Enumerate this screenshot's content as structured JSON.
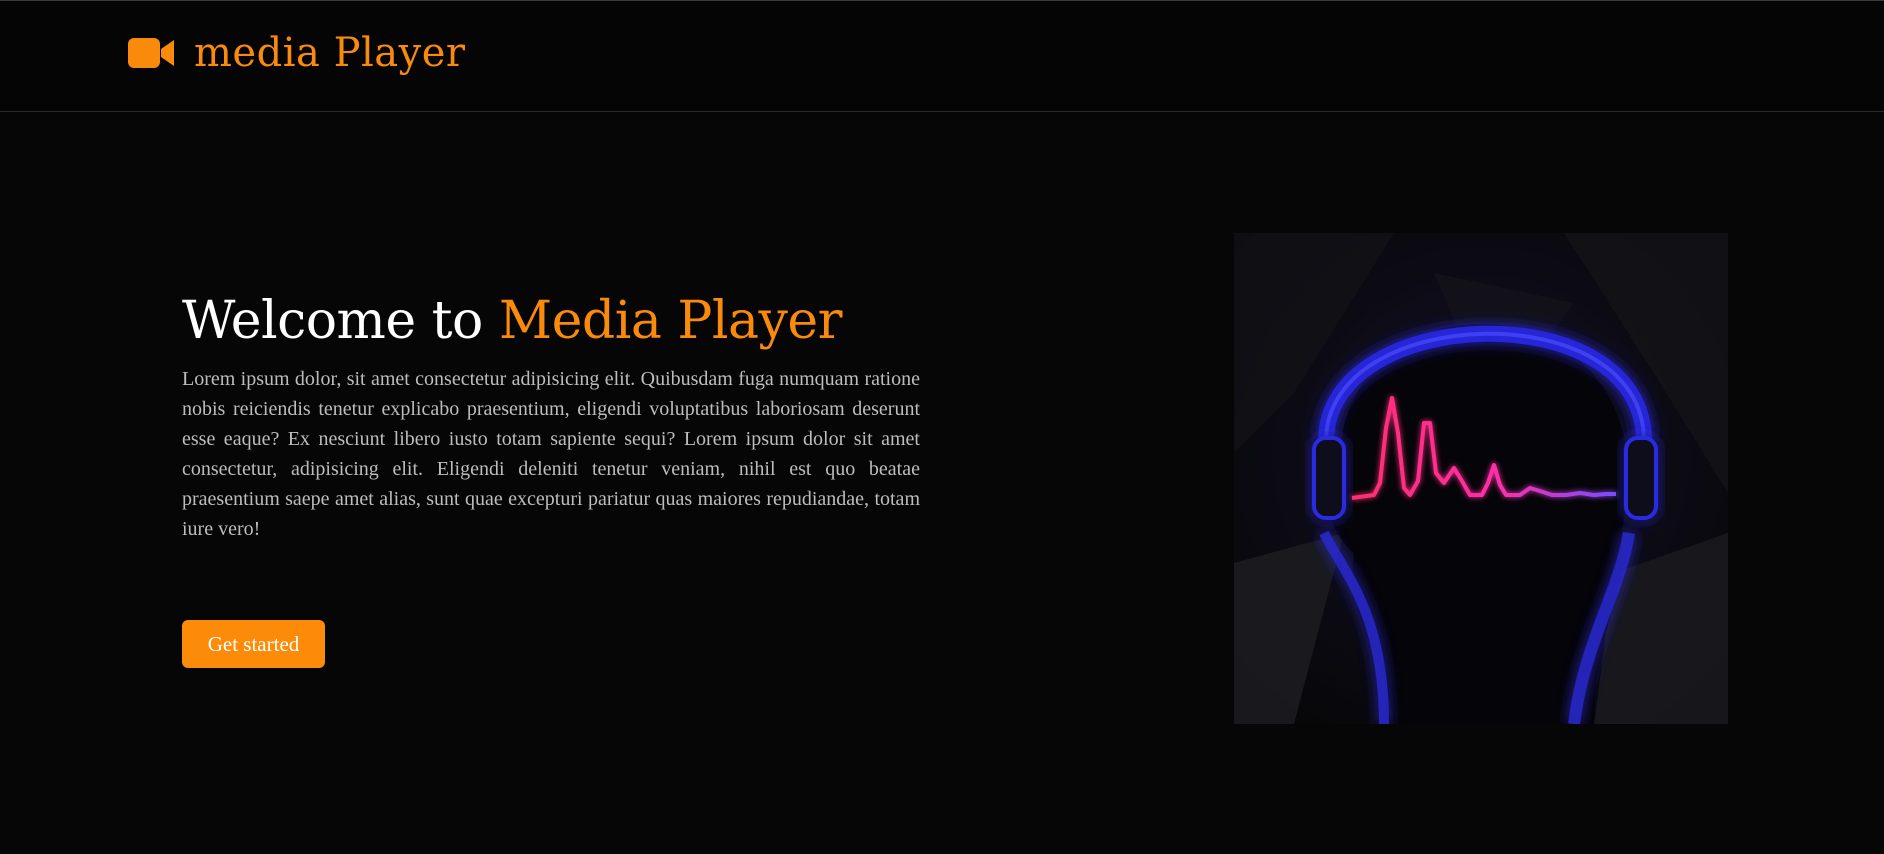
{
  "navbar": {
    "brand_icon": "video-camera-icon",
    "brand_title": "media Player",
    "accent_color": "#f98a0b"
  },
  "hero": {
    "heading_prefix": "Welcome to",
    "heading_accent": "Media Player",
    "body": "Lorem ipsum dolor, sit amet consectetur adipisicing elit. Quibusdam fuga numquam ratione nobis reiciendis tenetur explicabo praesentium, eligendi voluptatibus laboriosam deserunt esse eaque? Ex nesciunt libero iusto totam sapiente sequi? Lorem ipsum dolor sit amet consectetur, adipisicing elit. Eligendi deleniti tenetur veniam, nihil est quo beatae praesentium saepe amet alias, sunt quae excepturi pariatur quas maiores repudiandae, totam iure vero!",
    "cta_label": "Get started",
    "image": "headphones-soundwave-illustration"
  },
  "colors": {
    "background": "#060606",
    "accent": "#f98a0b",
    "heading": "#ffffff",
    "body_text": "#bdbdbd"
  }
}
